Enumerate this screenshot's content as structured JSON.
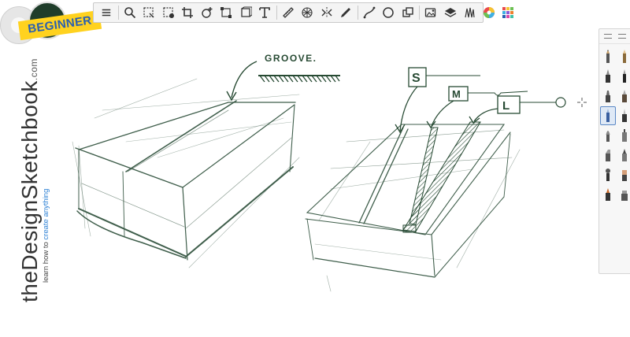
{
  "badge": {
    "label": "BEGINNER"
  },
  "annotations": {
    "groove": "GROOVE.",
    "small": "S",
    "medium": "M",
    "large": "L"
  },
  "brand": {
    "name": "theDesignSketchbook",
    "domain": ".com",
    "tagline_prefix": "learn how to ",
    "tagline_highlight": "create anything"
  },
  "toolbar": {
    "tools": [
      {
        "name": "menu-icon"
      },
      {
        "name": "search-icon"
      },
      {
        "name": "lasso-select-icon"
      },
      {
        "name": "lasso-fill-icon"
      },
      {
        "name": "crop-icon"
      },
      {
        "name": "add-layer-icon"
      },
      {
        "name": "transform-icon"
      },
      {
        "name": "flip-icon"
      },
      {
        "name": "text-icon"
      },
      {
        "name": "ruler-icon"
      },
      {
        "name": "perspective-grid-icon"
      },
      {
        "name": "symmetry-icon"
      },
      {
        "name": "pen-icon"
      },
      {
        "name": "curve-icon"
      },
      {
        "name": "ellipse-icon"
      },
      {
        "name": "shapes-icon"
      },
      {
        "name": "image-icon"
      },
      {
        "name": "layers-icon"
      },
      {
        "name": "brushes-icon"
      },
      {
        "name": "color-wheel-icon"
      },
      {
        "name": "color-grid-icon"
      }
    ]
  },
  "colors": {
    "ink": "#274a33",
    "toolbar_bg": "#f4f4f4",
    "badge_yellow": "#ffd21f",
    "badge_text": "#2a5fb0",
    "brand_highlight": "#2a7fd4"
  }
}
